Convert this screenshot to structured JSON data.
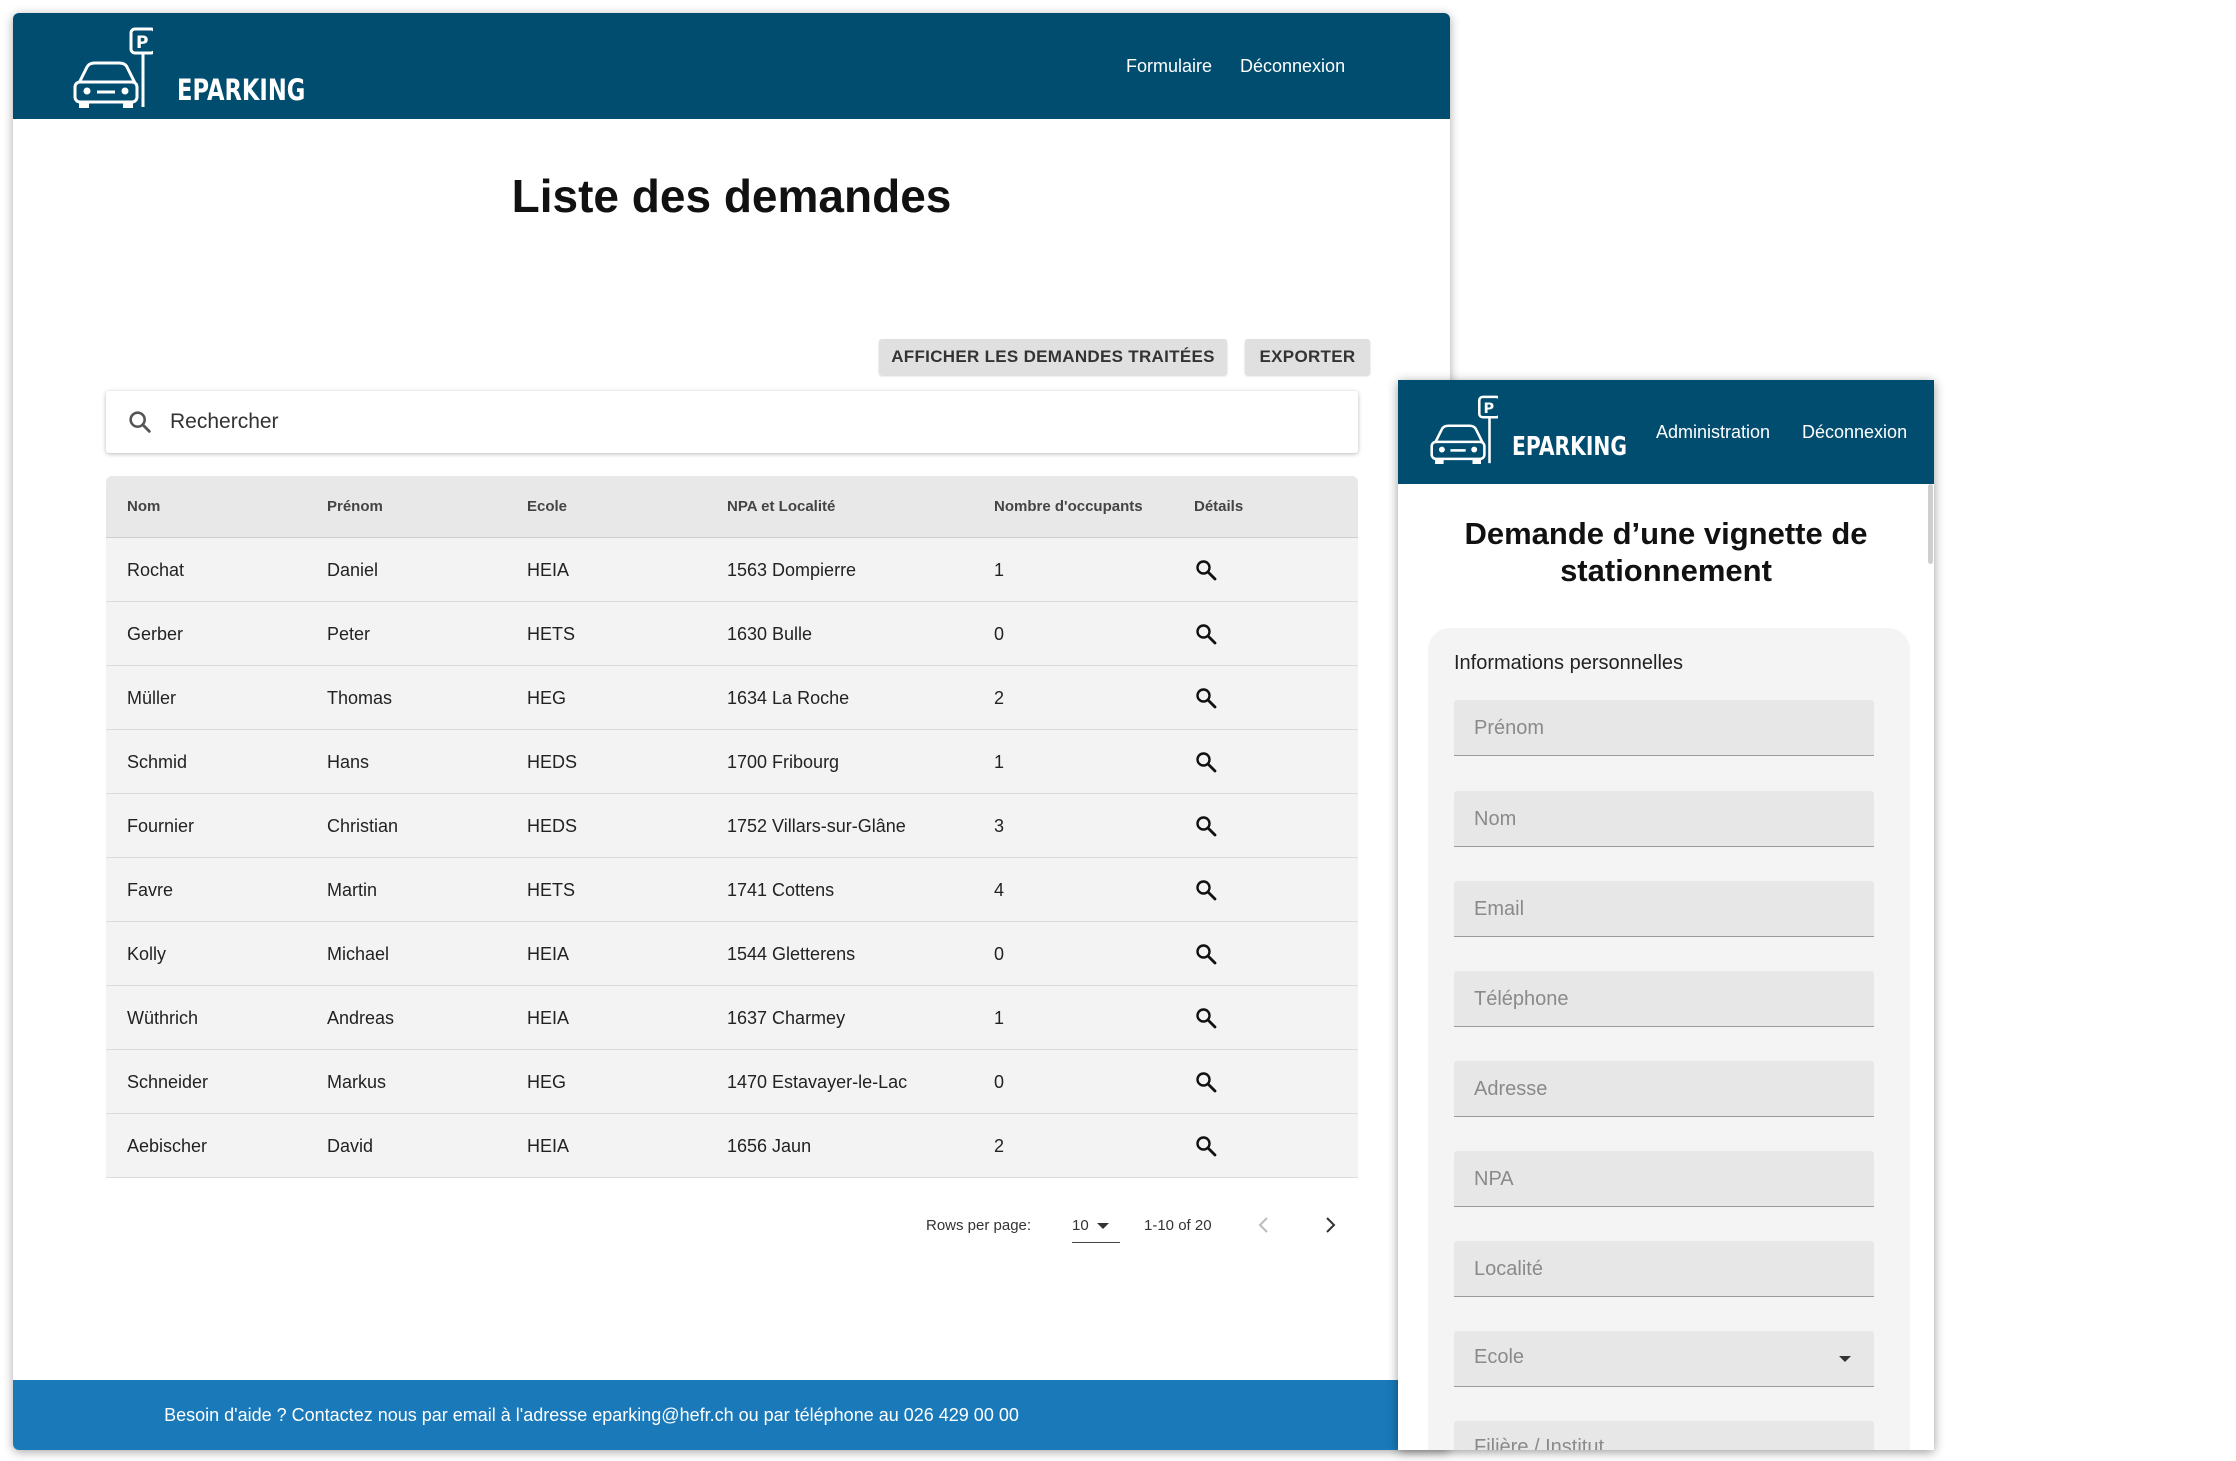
{
  "desktop": {
    "brand": "EPARKING",
    "nav": [
      "Formulaire",
      "Déconnexion"
    ],
    "title": "Liste des demandes",
    "buttons": {
      "show_processed": "AFFICHER LES DEMANDES TRAITÉES",
      "export": "EXPORTER"
    },
    "search": {
      "placeholder": "Rechercher"
    },
    "table": {
      "headers": [
        "Nom",
        "Prénom",
        "Ecole",
        "NPA et Localité",
        "Nombre d'occupants",
        "Détails"
      ],
      "rows": [
        [
          "Rochat",
          "Daniel",
          "HEIA",
          "1563 Dompierre",
          "1"
        ],
        [
          "Gerber",
          "Peter",
          "HETS",
          "1630 Bulle",
          "0"
        ],
        [
          "Müller",
          "Thomas",
          "HEG",
          "1634 La Roche",
          "2"
        ],
        [
          "Schmid",
          "Hans",
          "HEDS",
          "1700 Fribourg",
          "1"
        ],
        [
          "Fournier",
          "Christian",
          "HEDS",
          "1752 Villars-sur-Glâne",
          "3"
        ],
        [
          "Favre",
          "Martin",
          "HETS",
          "1741 Cottens",
          "4"
        ],
        [
          "Kolly",
          "Michael",
          "HEIA",
          "1544 Gletterens",
          "0"
        ],
        [
          "Wüthrich",
          "Andreas",
          "HEIA",
          "1637 Charmey",
          "1"
        ],
        [
          "Schneider",
          "Markus",
          "HEG",
          "1470 Estavayer-le-Lac",
          "0"
        ],
        [
          "Aebischer",
          "David",
          "HEIA",
          "1656 Jaun",
          "2"
        ]
      ]
    },
    "pagination": {
      "rows_label": "Rows per page:",
      "rows_value": "10",
      "range": "1-10 of 20"
    },
    "footer": "Besoin d'aide ? Contactez nous par email à l'adresse eparking@hefr.ch ou par téléphone au 026 429 00 00"
  },
  "mobile": {
    "brand": "EPARKING",
    "nav": [
      "Administration",
      "Déconnexion"
    ],
    "title_line1": "Demande d’une vignette de",
    "title_line2": "stationnement",
    "section": "Informations personnelles",
    "fields": [
      "Prénom",
      "Nom",
      "Email",
      "Téléphone",
      "Adresse",
      "NPA",
      "Localité"
    ],
    "select": "Ecole",
    "partial_field": "Filière / Institut"
  },
  "colors": {
    "header": "#004d70",
    "footer": "#1a79b9",
    "table_bg": "#f3f3f3"
  },
  "icons": [
    "parking-sign-icon",
    "car-icon",
    "search-icon",
    "magnifier-icon",
    "chevron-left-icon",
    "chevron-right-icon",
    "dropdown-arrow-icon"
  ]
}
